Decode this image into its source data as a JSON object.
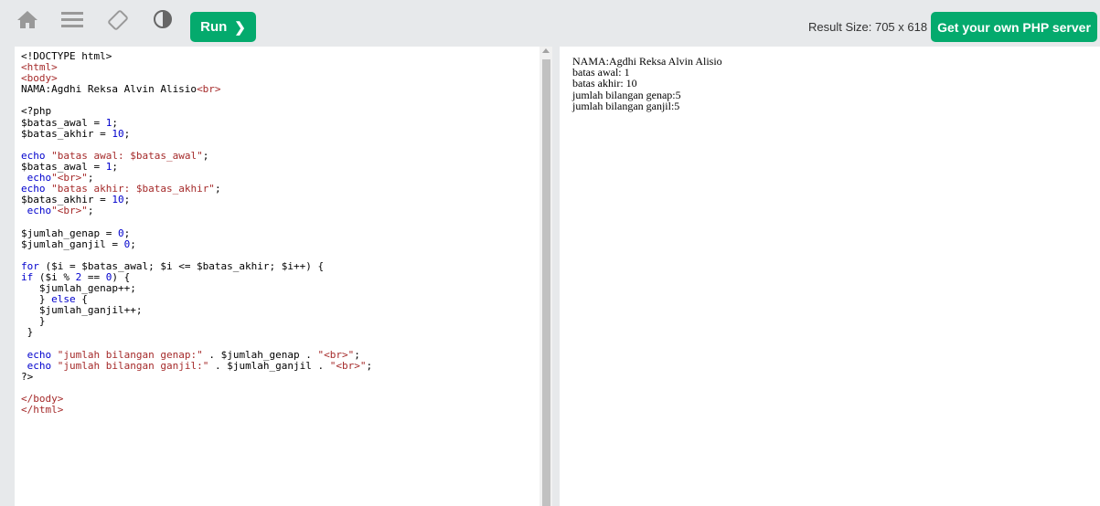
{
  "toolbar": {
    "icons": [
      "home-icon",
      "menu-icon",
      "rotate-icon",
      "contrast-icon"
    ],
    "run_label": "Run",
    "run_chevron": "❯",
    "result_size": "Result Size: 705 x 618",
    "own_server_label": "Get your own PHP server"
  },
  "editor": {
    "lines": [
      "<!DOCTYPE html>",
      "<html>",
      "<body>",
      "NAMA:Agdhi Reksa Alvin Alisio<br>",
      "",
      "<?php",
      "$batas_awal = 1;",
      "$batas_akhir = 10;",
      "",
      "echo \"batas awal: $batas_awal\";",
      "$batas_awal = 1;",
      " echo\"<br>\";",
      "echo \"batas akhir: $batas_akhir\";",
      "$batas_akhir = 10;",
      " echo\"<br>\";",
      "",
      "$jumlah_genap = 0;",
      "$jumlah_ganjil = 0;",
      "",
      "for ($i = $batas_awal; $i <= $batas_akhir; $i++) {",
      "if ($i % 2 == 0) {",
      "   $jumlah_genap++;",
      "   } else {",
      "   $jumlah_ganjil++;",
      "   }",
      " }",
      "",
      " echo \"jumlah bilangan genap:\" . $jumlah_genap . \"<br>\";",
      " echo \"jumlah bilangan ganjil:\" . $jumlah_ganjil . \"<br>\";",
      "?>",
      "",
      "</body>",
      "</html>"
    ]
  },
  "result": {
    "lines": [
      "NAMA:Agdhi Reksa Alvin Alisio",
      "batas awal: 1",
      "batas akhir: 10",
      "jumlah bilangan genap:5",
      "jumlah bilangan ganjil:5"
    ]
  },
  "colors": {
    "accent_green": "#04aa6d",
    "toolbar_bg": "#e7e9eb",
    "html_tag": "#a52a2a",
    "keyword": "#0000cd"
  }
}
